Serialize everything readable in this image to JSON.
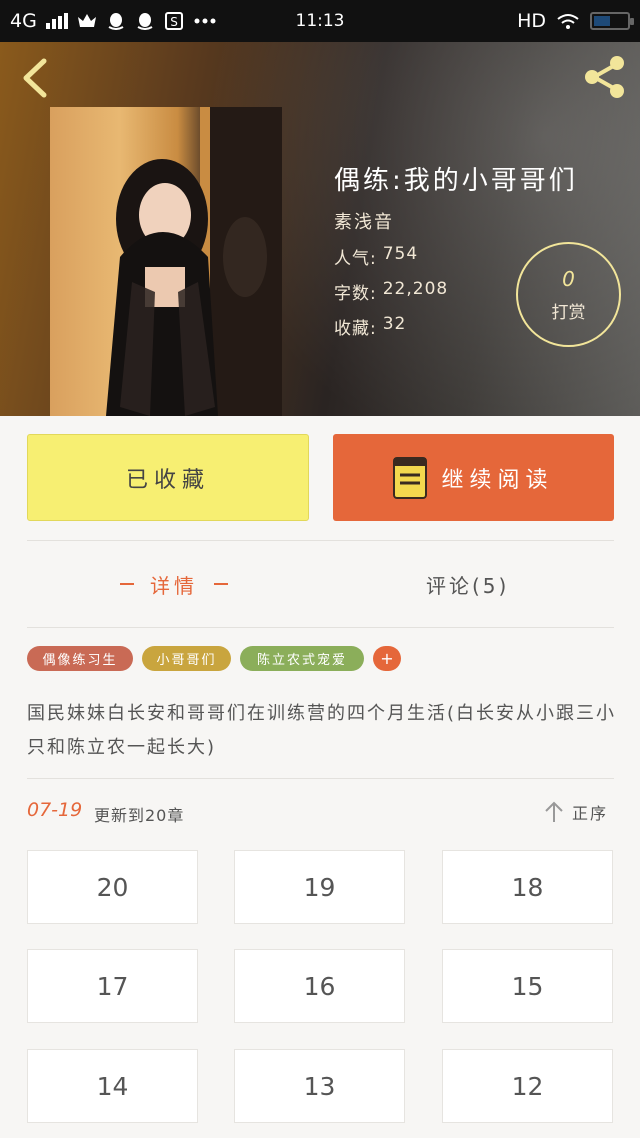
{
  "status_bar": {
    "network": "4G",
    "time": "11:13",
    "hd_label": "HD",
    "battery_level": 0.5,
    "icons": [
      "signal-icon",
      "crown-icon",
      "qq-icon",
      "qq-icon",
      "s-app-icon",
      "more-dots-icon",
      "wifi-icon",
      "battery-icon"
    ]
  },
  "header": {
    "back_icon": "chevron-left-icon",
    "share_icon": "share-icon",
    "accent_color": "#f2e59a"
  },
  "book": {
    "title": "偶练:我的小哥哥们",
    "author": "素浅音",
    "popularity_label": "人气:",
    "popularity_value": "754",
    "word_count_label": "字数:",
    "word_count_value": "22,208",
    "favorites_label": "收藏:",
    "favorites_value": "32",
    "tip_count": "0",
    "tip_label": "打赏"
  },
  "actions": {
    "favorited_label": "已收藏",
    "continue_label": "继续阅读",
    "favorited_color": "#f7ef72",
    "continue_color": "#e5673a"
  },
  "tabs": [
    {
      "label": "详情",
      "active": true
    },
    {
      "label": "评论(5)",
      "active": false
    }
  ],
  "tags": [
    {
      "label": "偶像练习生",
      "color": "#c96a55"
    },
    {
      "label": "小哥哥们",
      "color": "#c9a53e"
    },
    {
      "label": "陈立农式宠爱",
      "color": "#8bae5a"
    }
  ],
  "add_tag_label": "+",
  "description": "国民妹妹白长安和哥哥们在训练营的四个月生活(白长安从小跟三小只和陈立农一起长大)",
  "update": {
    "date": "07-19",
    "text": "更新到20章",
    "sort_label": "正序"
  },
  "chapters": [
    "20",
    "19",
    "18",
    "17",
    "16",
    "15",
    "14",
    "13",
    "12"
  ]
}
